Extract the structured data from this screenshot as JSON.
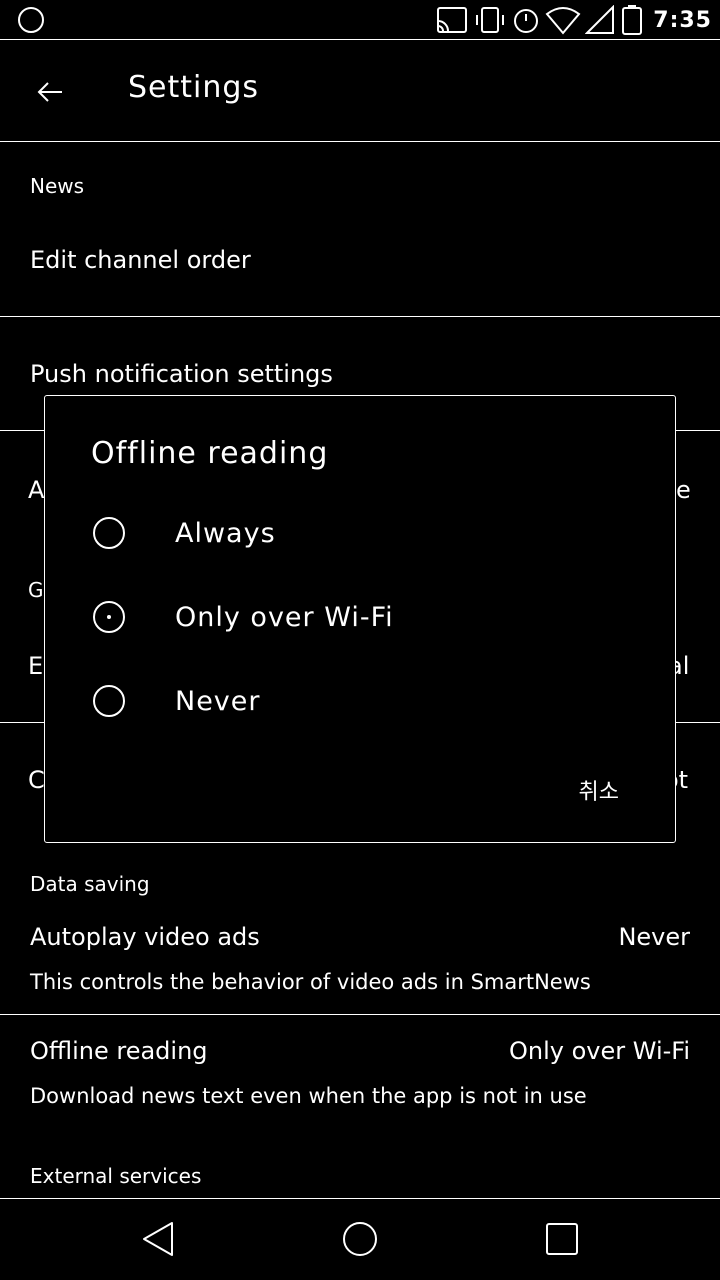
{
  "status_bar": {
    "time": "7:35"
  },
  "app_bar": {
    "title": "Settings"
  },
  "sections": {
    "news": {
      "header": "News",
      "edit_channel_order": "Edit channel order",
      "push_notification_settings": "Push notification settings"
    },
    "data_saving": {
      "header": "Data saving",
      "autoplay_label": "Autoplay video ads",
      "autoplay_value": "Never",
      "autoplay_sub": "This controls the behavior of video ads in SmartNews",
      "offline_label": "Offline reading",
      "offline_value": "Only over Wi-Fi",
      "offline_sub": "Download news text even when the app is not in use"
    },
    "external": {
      "header": "External services"
    }
  },
  "obscured": {
    "row1_left": "A",
    "row1_right": "e",
    "row2_left": "G",
    "row3_left": "E",
    "row3_right": "al",
    "row4_left": "C",
    "row4_right": "ot"
  },
  "dialog": {
    "title": "Offline reading",
    "options": [
      {
        "label": "Always",
        "selected": false
      },
      {
        "label": "Only over Wi-Fi",
        "selected": true
      },
      {
        "label": "Never",
        "selected": false
      }
    ],
    "cancel": "취소"
  },
  "icons": {
    "back": "arrow-left-icon",
    "nav_back": "triangle-back-icon",
    "nav_home": "circle-home-icon",
    "nav_recents": "square-recents-icon"
  }
}
